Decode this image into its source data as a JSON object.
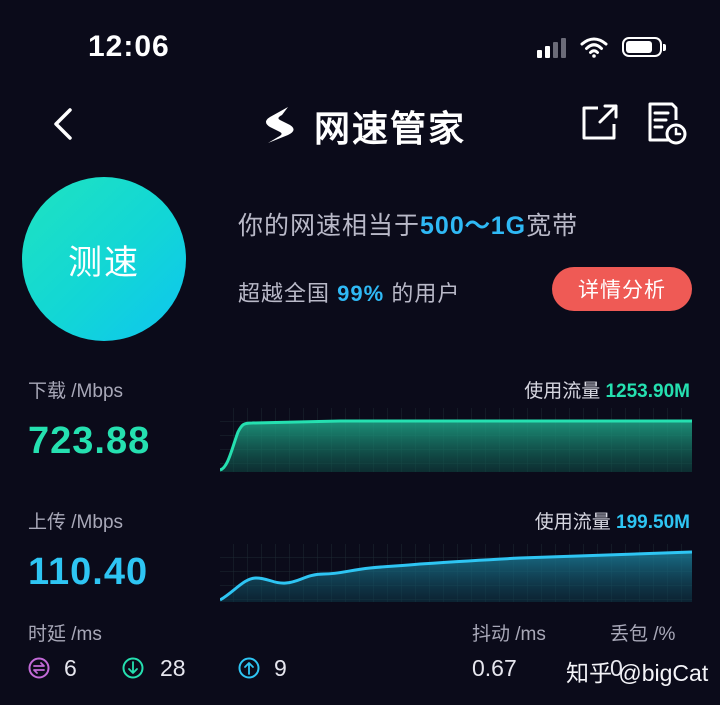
{
  "status_bar": {
    "time": "12:06"
  },
  "header": {
    "title": "网速管家"
  },
  "test_button": {
    "label": "测速"
  },
  "summary": {
    "line1_prefix": "你的网速相当于",
    "line1_value": "500～1G",
    "line1_suffix": "宽带",
    "line2_prefix": "超越全国",
    "line2_value": "99%",
    "line2_suffix": "的用户",
    "detail_label": "详情分析"
  },
  "download": {
    "label": "下载 /Mbps",
    "value": "723.88",
    "usage_label": "使用流量",
    "usage_value": "1253.90M",
    "color": "#25e0b0"
  },
  "upload": {
    "label": "上传 /Mbps",
    "value": "110.40",
    "usage_label": "使用流量",
    "usage_value": "199.50M",
    "color": "#2ec5f3"
  },
  "metrics": {
    "latency_label": "时延 /ms",
    "jitter_label": "抖动 /ms",
    "loss_label": "丢包 /%",
    "latency_idle": "6",
    "latency_down": "28",
    "latency_up": "9",
    "jitter_value": "0.67",
    "loss_value": "0"
  },
  "icons": {
    "idle_color": "#c36ad8",
    "down_color": "#25e0b0",
    "up_color": "#2ec5f3"
  },
  "watermark": "知乎 @bigCat"
}
